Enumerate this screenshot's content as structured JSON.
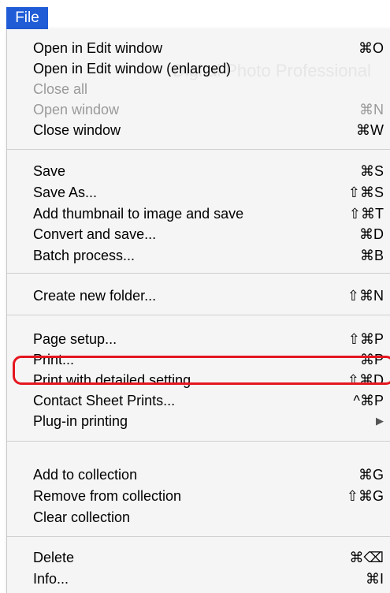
{
  "menubar": {
    "title": "File"
  },
  "menu": {
    "items": [
      {
        "label": "Open in Edit window",
        "shortcut": "⌘O"
      },
      {
        "label": "Open in Edit window (enlarged)",
        "shortcut": ""
      },
      {
        "label": "Close all",
        "shortcut": ""
      },
      {
        "label": "Open window",
        "shortcut": "⌘N"
      },
      {
        "label": "Close window",
        "shortcut": "⌘W"
      },
      {
        "label": "Save",
        "shortcut": "⌘S"
      },
      {
        "label": "Save As...",
        "shortcut": "⇧⌘S"
      },
      {
        "label": "Add thumbnail to image and save",
        "shortcut": "⇧⌘T"
      },
      {
        "label": "Convert and save...",
        "shortcut": "⌘D"
      },
      {
        "label": "Batch process...",
        "shortcut": "⌘B"
      },
      {
        "label": "Create new folder...",
        "shortcut": "⇧⌘N"
      },
      {
        "label": "Page setup...",
        "shortcut": "⇧⌘P"
      },
      {
        "label": "Print...",
        "shortcut": "⌘P"
      },
      {
        "label": "Print with detailed setting...",
        "shortcut": "⇧⌘D"
      },
      {
        "label": "Contact Sheet Prints...",
        "shortcut": "^⌘P"
      },
      {
        "label": "Plug-in printing",
        "shortcut": "▶"
      },
      {
        "label": "Add to collection",
        "shortcut": "⌘G"
      },
      {
        "label": "Remove from collection",
        "shortcut": "⇧⌘G"
      },
      {
        "label": "Clear collection",
        "shortcut": ""
      },
      {
        "label": "Delete",
        "shortcut": "⌘⌫"
      },
      {
        "label": "Info...",
        "shortcut": "⌘I"
      }
    ]
  },
  "colors": {
    "menubar_highlight": "#1f5cd6",
    "annotation_outline": "#e5161f",
    "disabled_text": "#9a9a9a"
  }
}
